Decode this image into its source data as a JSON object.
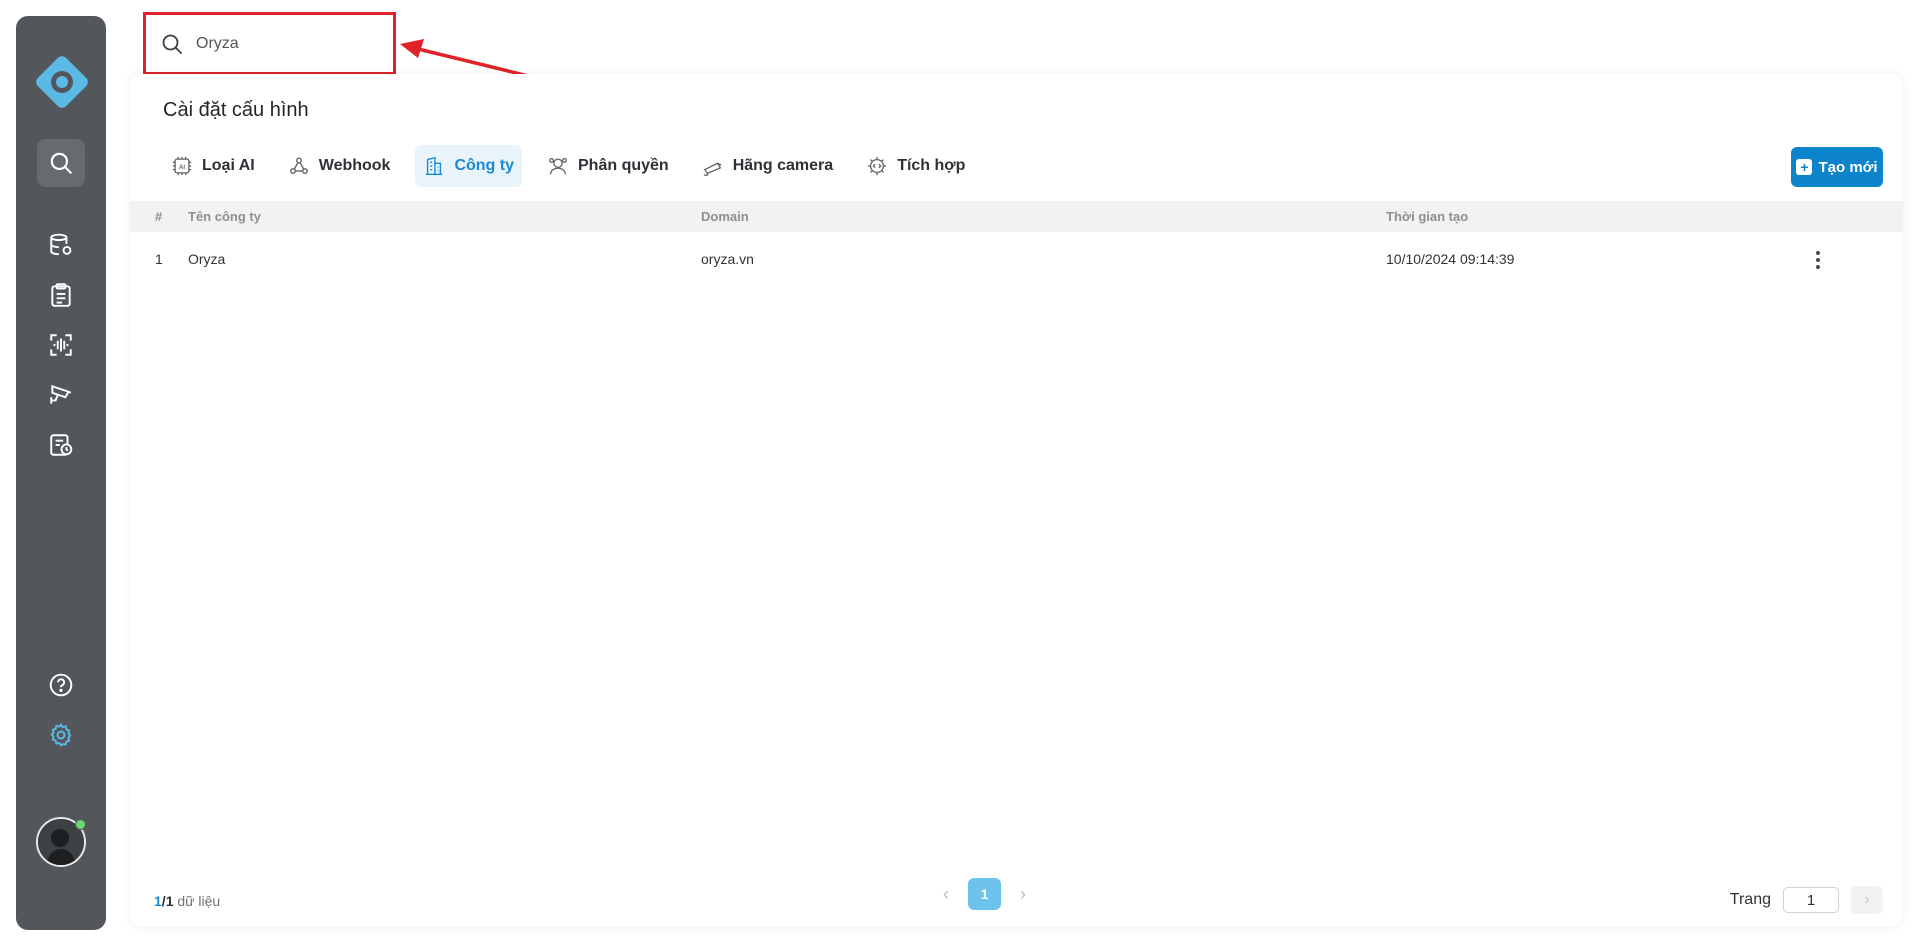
{
  "search": {
    "value": "Oryza",
    "icon": "search-icon"
  },
  "sidebar": {
    "brand_color": "#5bb9e5",
    "top_items": [
      {
        "name": "search",
        "icon": "search-icon",
        "active": true
      },
      {
        "name": "database",
        "icon": "database-settings-icon"
      },
      {
        "name": "clipboard",
        "icon": "clipboard-list-icon"
      },
      {
        "name": "scan",
        "icon": "face-scan-icon"
      },
      {
        "name": "camera",
        "icon": "cctv-camera-icon"
      },
      {
        "name": "report",
        "icon": "report-clock-icon"
      }
    ],
    "bottom_items": [
      {
        "name": "help",
        "icon": "question-circle-icon"
      },
      {
        "name": "settings",
        "icon": "gear-icon",
        "active": true
      }
    ]
  },
  "page": {
    "title": "Cài đặt cấu hình"
  },
  "tabs": [
    {
      "label": "Loại AI",
      "icon": "ai-chip-icon"
    },
    {
      "label": "Webhook",
      "icon": "webhook-icon"
    },
    {
      "label": "Công ty",
      "icon": "building-icon",
      "active": true
    },
    {
      "label": "Phân quyền",
      "icon": "user-group-icon"
    },
    {
      "label": "Hãng camera",
      "icon": "camera-icon"
    },
    {
      "label": "Tích hợp",
      "icon": "integration-chip-icon"
    }
  ],
  "actions": {
    "create_label": "Tạo mới"
  },
  "table": {
    "headers": [
      "#",
      "Tên công ty",
      "Domain",
      "Thời gian tạo"
    ],
    "rows": [
      {
        "index": "1",
        "name": "Oryza",
        "domain": "oryza.vn",
        "created": "10/10/2024 09:14:39"
      }
    ]
  },
  "pagination": {
    "current": "1",
    "total": "1",
    "suffix": "dữ liệu",
    "active_page": "1",
    "goto_label": "Trang",
    "goto_value": "1"
  },
  "colors": {
    "accent": "#0c84cb",
    "sidebar": "#53575b",
    "highlight_box": "#e0222a"
  }
}
